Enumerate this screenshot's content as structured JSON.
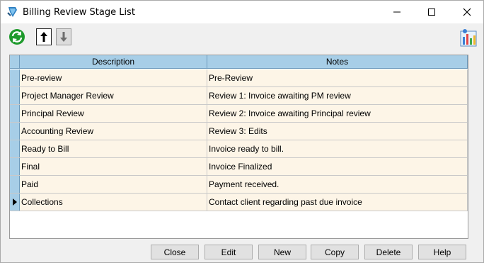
{
  "window": {
    "title": "Billing Review Stage List",
    "controls": {
      "minimize": "—",
      "maximize": "☐",
      "close": "✕"
    }
  },
  "toolbar": {
    "refresh_icon": "refresh-icon",
    "move_up_icon": "arrow-up-icon",
    "move_down_icon": "arrow-down-icon",
    "chart_icon": "chart-icon"
  },
  "grid": {
    "columns": [
      "Description",
      "Notes"
    ],
    "rows": [
      {
        "description": "Pre-review",
        "notes": "Pre-Review",
        "current": false
      },
      {
        "description": "Project Manager Review",
        "notes": "Review 1: Invoice awaiting PM review",
        "current": false
      },
      {
        "description": "Principal Review",
        "notes": "Review 2: Invoice awaiting Principal review",
        "current": false
      },
      {
        "description": "Accounting Review",
        "notes": "Review 3: Edits",
        "current": false
      },
      {
        "description": "Ready to Bill",
        "notes": "Invoice ready to bill.",
        "current": false
      },
      {
        "description": "Final",
        "notes": "Invoice Finalized",
        "current": false
      },
      {
        "description": "Paid",
        "notes": "Payment received.",
        "current": false
      },
      {
        "description": "Collections",
        "notes": "Contact client regarding past due invoice",
        "current": true
      }
    ]
  },
  "buttons": {
    "close": "Close",
    "edit": "Edit",
    "new": "New",
    "copy": "Copy",
    "delete": "Delete",
    "help": "Help"
  },
  "colors": {
    "header_bg": "#a7cee7",
    "row_bg": "#fdf5e7",
    "refresh_green": "#1e9a2c"
  }
}
